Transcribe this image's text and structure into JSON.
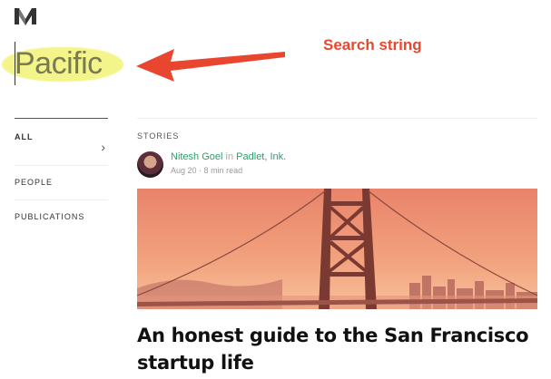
{
  "app": {
    "logo_icon": "medium-logo-icon"
  },
  "search": {
    "value": "Pacific"
  },
  "annotation": {
    "label": "Search string",
    "color": "#e8462f"
  },
  "sidebar": {
    "items": [
      {
        "label": "ALL",
        "selected": true
      },
      {
        "label": "PEOPLE"
      },
      {
        "label": "PUBLICATIONS"
      }
    ]
  },
  "main": {
    "section_label": "STORIES",
    "story": {
      "author": "Nitesh Goel",
      "in_word": "in",
      "publication": "Padlet, Ink.",
      "date": "Aug 20",
      "separator": "·",
      "read_time": "8 min read",
      "title": "An honest guide to the San Francisco startup life"
    }
  },
  "colors": {
    "accent_green": "#2e9e6a",
    "highlight_yellow": "#f3f58a"
  }
}
